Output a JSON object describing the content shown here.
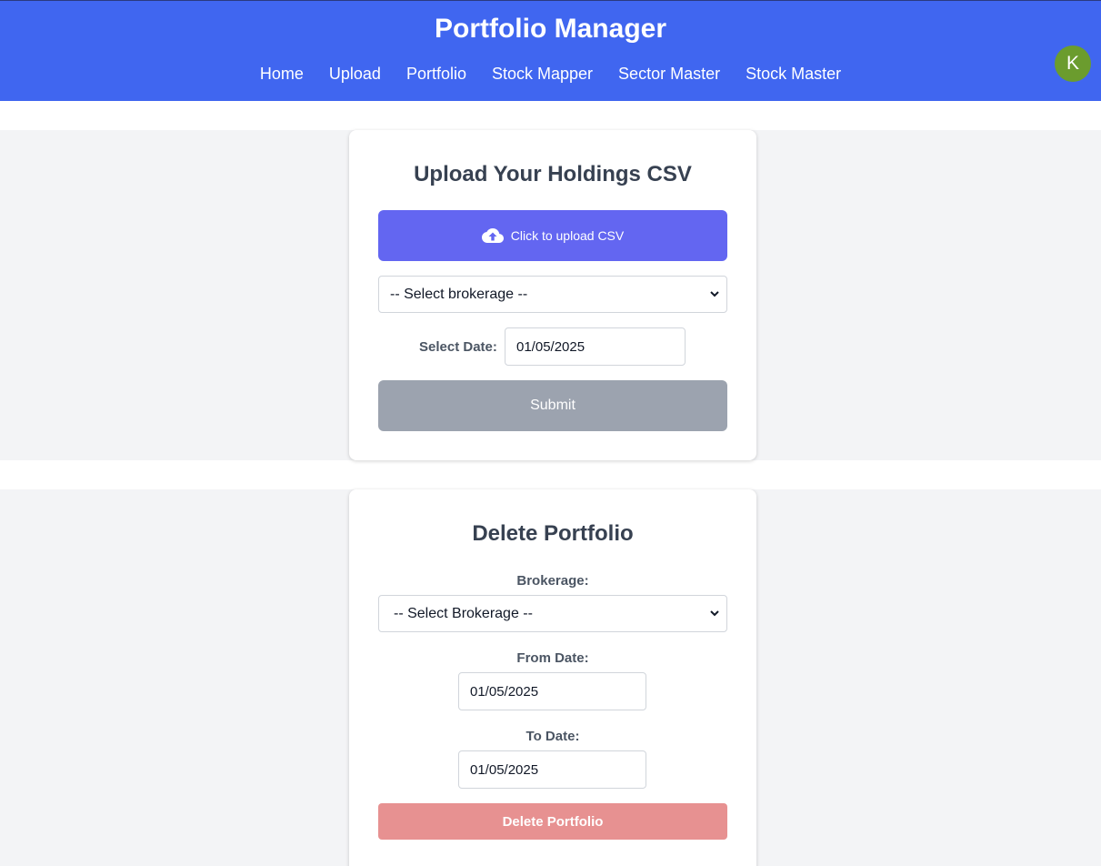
{
  "header": {
    "title": "Portfolio Manager",
    "nav": [
      "Home",
      "Upload",
      "Portfolio",
      "Stock Mapper",
      "Sector Master",
      "Stock Master"
    ],
    "avatar_initial": "K"
  },
  "upload_card": {
    "title": "Upload Your Holdings CSV",
    "upload_label": "Click to upload CSV",
    "upload_icon": "cloud-upload-icon",
    "brokerage_selected": "-- Select brokerage --",
    "date_label": "Select Date:",
    "date_value": "01/05/2025",
    "submit_label": "Submit"
  },
  "delete_card": {
    "title": "Delete Portfolio",
    "brokerage_label": "Brokerage:",
    "brokerage_selected": "-- Select Brokerage --",
    "from_label": "From Date:",
    "from_value": "01/05/2025",
    "to_label": "To Date:",
    "to_value": "01/05/2025",
    "delete_label": "Delete Portfolio"
  },
  "colors": {
    "header_bg": "#4066f0",
    "upload_button": "#6366f1",
    "submit_disabled": "#9ca3af",
    "delete_disabled": "#e79191",
    "avatar": "#6b9c2e",
    "band_bg": "#f3f4f6"
  }
}
